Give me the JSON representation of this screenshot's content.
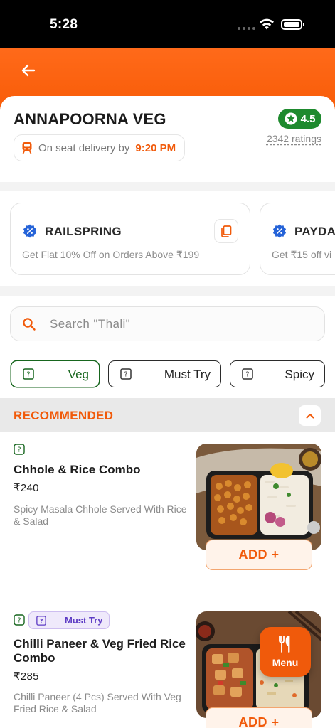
{
  "status_bar": {
    "time": "5:28"
  },
  "restaurant": {
    "name": "ANNAPOORNA VEG",
    "delivery_text": "On seat delivery by",
    "delivery_time": "9:20 PM",
    "rating": "4.5",
    "ratings_count": "2342 ratings"
  },
  "offers": [
    {
      "code": "RAILSPRING",
      "description": "Get Flat 10% Off on Orders Above ₹199"
    },
    {
      "code": "PAYDA",
      "description": "Get ₹15 off vi"
    }
  ],
  "search": {
    "placeholder": "Search \"Thali\""
  },
  "filters": [
    {
      "label": "Veg",
      "active": true
    },
    {
      "label": "Must Try",
      "active": false
    },
    {
      "label": "Spicy",
      "active": false
    }
  ],
  "section": {
    "title": "RECOMMENDED"
  },
  "dishes": [
    {
      "name": "Chhole & Rice Combo",
      "price": "₹240",
      "description": "Spicy Masala Chhole Served With Rice & Salad",
      "add_label": "ADD +"
    },
    {
      "tag": "Must Try",
      "name": "Chilli Paneer & Veg Fried Rice Combo",
      "price": "₹285",
      "description": "Chilli Paneer (4 Pcs) Served With Veg Fried Rice & Salad",
      "add_label": "ADD +"
    }
  ],
  "menu_fab": {
    "label": "Menu"
  },
  "colors": {
    "brand_orange": "#f15a0a",
    "veg_green": "#17661e",
    "rating_green": "#1e8a2e",
    "tag_purple": "#5d3bc4"
  }
}
